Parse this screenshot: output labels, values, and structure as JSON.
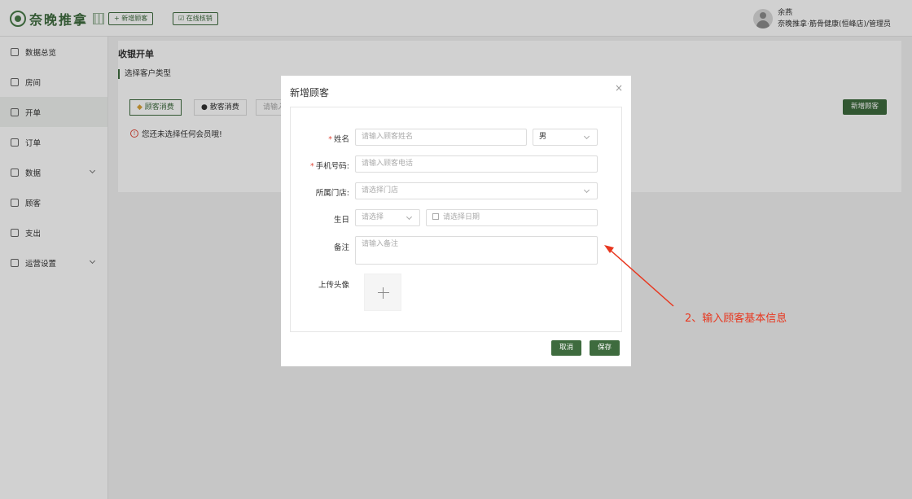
{
  "app": {
    "logo_text": "奈晚推拿",
    "top_buttons": [
      "+ 新增顾客",
      "☑ 在线核销"
    ]
  },
  "user": {
    "name": "余燕",
    "role": "奈晚推拿·筋骨健康(恒峰店)/管理员"
  },
  "sidebar": {
    "items": [
      {
        "label": "数据总览",
        "icon": "monitor-icon"
      },
      {
        "label": "房间",
        "icon": "home-icon"
      },
      {
        "label": "开单",
        "icon": "document-icon",
        "active": true
      },
      {
        "label": "订单",
        "icon": "list-icon"
      },
      {
        "label": "数据",
        "icon": "chart-icon",
        "expandable": true
      },
      {
        "label": "顾客",
        "icon": "user-icon"
      },
      {
        "label": "支出",
        "icon": "wallet-icon"
      },
      {
        "label": "运营设置",
        "icon": "settings-icon",
        "expandable": true
      }
    ]
  },
  "main": {
    "page_title": "收银开单",
    "section_title": "选择客户类型",
    "tabs": [
      "顾客消费",
      "散客消费",
      "请输入"
    ],
    "warning": "您还未选择任何会员哦!",
    "new_customer_button": "新增顾客"
  },
  "modal": {
    "title": "新增顾客",
    "close": "×",
    "fields": {
      "name_label": "姓名",
      "name_placeholder": "请输入顾客姓名",
      "gender_value": "男",
      "phone_label": "手机号码:",
      "phone_placeholder": "请输入顾客电话",
      "store_label": "所属门店:",
      "store_placeholder": "请选择门店",
      "birthday_label": "生日",
      "birthday_type_placeholder": "请选择",
      "birthday_date_placeholder": "请选择日期",
      "remark_label": "备注",
      "remark_placeholder": "请输入备注",
      "avatar_label": "上传头像"
    },
    "cancel": "取消",
    "save": "保存"
  },
  "annotation": {
    "text": "2、输入顾客基本信息",
    "color": "#e8371f"
  },
  "colors": {
    "brand": "#3e6b3e",
    "required": "#e04b3c"
  }
}
